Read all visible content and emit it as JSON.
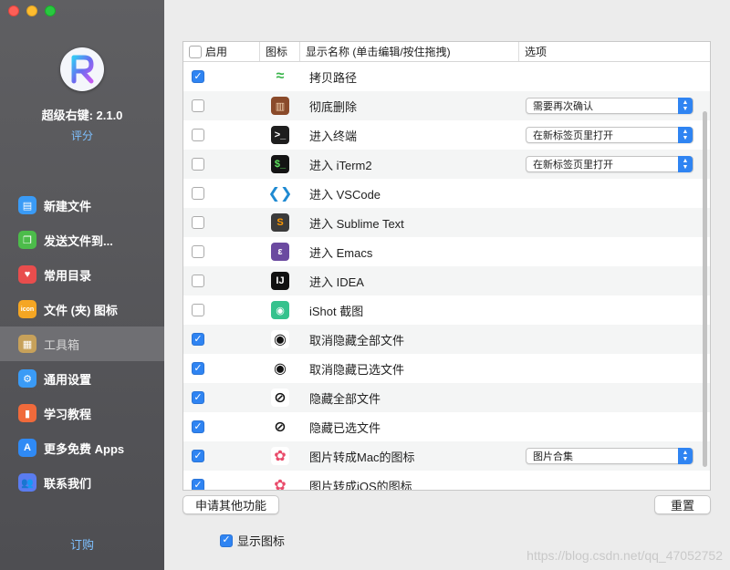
{
  "window": {
    "traffic_lights": [
      "close",
      "minimize",
      "zoom"
    ]
  },
  "sidebar": {
    "app_name_version": "超级右键: 2.1.0",
    "rate_label": "评分",
    "subscribe_label": "订购",
    "items": [
      {
        "label": "新建文件",
        "icon": "new-file-icon",
        "color": "#3a9bf6",
        "glyph": "▤"
      },
      {
        "label": "发送文件到...",
        "icon": "send-file-icon",
        "color": "#4cbc4a",
        "glyph": "❐"
      },
      {
        "label": "常用目录",
        "icon": "heart-folder-icon",
        "color": "#e84d4d",
        "glyph": "♥"
      },
      {
        "label": "文件 (夹) 图标",
        "icon": "icon-badge-icon",
        "color": "#f5a623",
        "glyph": "icon"
      },
      {
        "label": "工具箱",
        "icon": "toolbox-icon",
        "color": "#c7a15a",
        "glyph": "▦",
        "active": true
      },
      {
        "label": "通用设置",
        "icon": "gear-icon",
        "color": "#3a9bf6",
        "glyph": "⚙"
      },
      {
        "label": "学习教程",
        "icon": "tutorial-icon",
        "color": "#f06a3b",
        "glyph": "▮"
      },
      {
        "label": "更多免费 Apps",
        "icon": "app-store-icon",
        "color": "#2f8af5",
        "glyph": "A"
      },
      {
        "label": "联系我们",
        "icon": "contacts-icon",
        "color": "#5a7cf0",
        "glyph": "👥"
      }
    ]
  },
  "table": {
    "headers": {
      "enable": "启用",
      "icon": "图标",
      "name": "显示名称 (单击编辑/按住拖拽)",
      "options": "选项"
    },
    "rows": [
      {
        "checked": true,
        "name": "拷贝路径",
        "icon": "copy-path-icon",
        "icon_bg": "#ffffff",
        "icon_glyph": "≈",
        "icon_fg": "#39b54a",
        "option": ""
      },
      {
        "checked": false,
        "name": "彻底删除",
        "icon": "trash-icon",
        "icon_bg": "#8a4a2a",
        "icon_glyph": "▥",
        "icon_fg": "#f3d2b0",
        "option": "需要再次确认"
      },
      {
        "checked": false,
        "name": "进入终端",
        "icon": "terminal-icon",
        "icon_bg": "#1e1e1e",
        "icon_glyph": ">_",
        "icon_fg": "#ffffff",
        "option": "在新标签页里打开"
      },
      {
        "checked": false,
        "name": "进入 iTerm2",
        "icon": "iterm2-icon",
        "icon_bg": "#141414",
        "icon_glyph": "$_",
        "icon_fg": "#5fe35f",
        "option": "在新标签页里打开"
      },
      {
        "checked": false,
        "name": "进入 VSCode",
        "icon": "vscode-icon",
        "icon_bg": "#ffffff",
        "icon_glyph": "❮❯",
        "icon_fg": "#1f8ad2",
        "option": ""
      },
      {
        "checked": false,
        "name": "进入 Sublime Text",
        "icon": "sublime-icon",
        "icon_bg": "#3b3b3b",
        "icon_glyph": "S",
        "icon_fg": "#ff9800",
        "option": ""
      },
      {
        "checked": false,
        "name": "进入 Emacs",
        "icon": "emacs-icon",
        "icon_bg": "#6b4aa0",
        "icon_glyph": "ε",
        "icon_fg": "#ffffff",
        "option": ""
      },
      {
        "checked": false,
        "name": "进入 IDEA",
        "icon": "idea-icon",
        "icon_bg": "#111111",
        "icon_glyph": "IJ",
        "icon_fg": "#ffffff",
        "option": ""
      },
      {
        "checked": false,
        "name": "iShot 截图",
        "icon": "ishot-icon",
        "icon_bg": "#35c28d",
        "icon_glyph": "◉",
        "icon_fg": "#ffffff",
        "option": ""
      },
      {
        "checked": true,
        "name": "取消隐藏全部文件",
        "icon": "eye-icon",
        "icon_bg": "#ffffff",
        "icon_glyph": "◉",
        "icon_fg": "#111111",
        "option": ""
      },
      {
        "checked": true,
        "name": "取消隐藏已选文件",
        "icon": "eye-icon",
        "icon_bg": "#ffffff",
        "icon_glyph": "◉",
        "icon_fg": "#111111",
        "option": ""
      },
      {
        "checked": true,
        "name": "隐藏全部文件",
        "icon": "eye-slash-icon",
        "icon_bg": "#ffffff",
        "icon_glyph": "⊘",
        "icon_fg": "#111111",
        "option": ""
      },
      {
        "checked": true,
        "name": "隐藏已选文件",
        "icon": "eye-slash-icon",
        "icon_bg": "#ffffff",
        "icon_glyph": "⊘",
        "icon_fg": "#111111",
        "option": ""
      },
      {
        "checked": true,
        "name": "图片转成Mac的图标",
        "icon": "photos-icon",
        "icon_bg": "#ffffff",
        "icon_glyph": "✿",
        "icon_fg": "#e94b6a",
        "option": "图片合集"
      },
      {
        "checked": true,
        "name": "图片转成iOS的图标",
        "icon": "photos-icon",
        "icon_bg": "#ffffff",
        "icon_glyph": "✿",
        "icon_fg": "#e94b6a",
        "option": ""
      }
    ]
  },
  "buttons": {
    "request_feature": "申请其他功能",
    "reset": "重置"
  },
  "show_icons": {
    "label": "显示图标",
    "checked": true
  },
  "watermark": "https://blog.csdn.net/qq_47052752",
  "colors": {
    "accent": "#2f84f2",
    "link": "#7ec0ff"
  }
}
